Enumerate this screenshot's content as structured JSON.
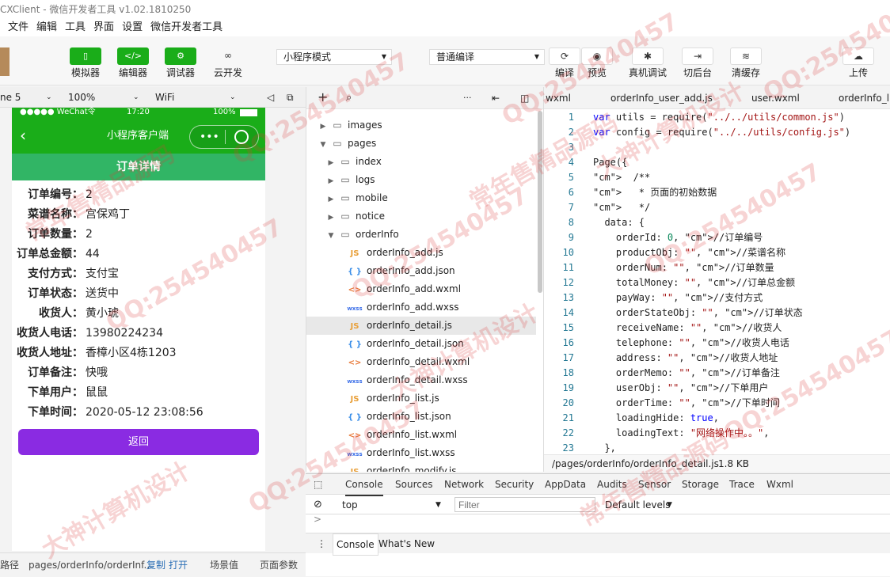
{
  "app": {
    "title": "CXClient - 微信开发者工具 v1.02.1810250"
  },
  "menu": [
    "文件",
    "编辑",
    "工具",
    "界面",
    "设置",
    "微信开发者工具"
  ],
  "toolbar": {
    "simulator": "模拟器",
    "editor": "编辑器",
    "debugger": "调试器",
    "cloud": "云开发",
    "mode": "小程序模式",
    "compile": "普通编译",
    "compile_btn": "编译",
    "preview": "预览",
    "device_debug": "真机调试",
    "background": "切后台",
    "cache": "清缓存",
    "upload": "上传"
  },
  "simbar": {
    "device": "ne 5",
    "zoom": "100%",
    "network": "WiFi"
  },
  "phone": {
    "carrier": "●●●●● WeChat令",
    "time": "17:20",
    "battery": "100%",
    "nav_title": "小程序客户端",
    "page_title": "订单详情",
    "fields": [
      {
        "k": "订单编号：",
        "v": "2"
      },
      {
        "k": "菜谱名称：",
        "v": "宫保鸡丁"
      },
      {
        "k": "订单数量：",
        "v": "2"
      },
      {
        "k": "订单总金额：",
        "v": "44"
      },
      {
        "k": "支付方式：",
        "v": "支付宝"
      },
      {
        "k": "订单状态：",
        "v": "送货中"
      },
      {
        "k": "收货人：",
        "v": "黄小琥"
      },
      {
        "k": "收货人电话：",
        "v": "13980224234"
      },
      {
        "k": "收货人地址：",
        "v": "香樟小区4栋1203"
      },
      {
        "k": "订单备注：",
        "v": "快哦"
      },
      {
        "k": "下单用户：",
        "v": "鼠鼠"
      },
      {
        "k": "下单时间：",
        "v": "2020-05-12 23:08:56"
      }
    ],
    "back": "返回"
  },
  "tree": [
    {
      "label": "images",
      "type": "folder",
      "depth": 0,
      "open": false
    },
    {
      "label": "pages",
      "type": "folder",
      "depth": 0,
      "open": true
    },
    {
      "label": "index",
      "type": "folder",
      "depth": 1,
      "open": false
    },
    {
      "label": "logs",
      "type": "folder",
      "depth": 1,
      "open": false
    },
    {
      "label": "mobile",
      "type": "folder",
      "depth": 1,
      "open": false
    },
    {
      "label": "notice",
      "type": "folder",
      "depth": 1,
      "open": false
    },
    {
      "label": "orderInfo",
      "type": "folder",
      "depth": 1,
      "open": true
    },
    {
      "label": "orderInfo_add.js",
      "type": "js",
      "depth": 2
    },
    {
      "label": "orderInfo_add.json",
      "type": "json",
      "depth": 2
    },
    {
      "label": "orderInfo_add.wxml",
      "type": "wxml",
      "depth": 2
    },
    {
      "label": "orderInfo_add.wxss",
      "type": "wxss",
      "depth": 2
    },
    {
      "label": "orderInfo_detail.js",
      "type": "js",
      "depth": 2,
      "selected": true
    },
    {
      "label": "orderInfo_detail.json",
      "type": "json",
      "depth": 2
    },
    {
      "label": "orderInfo_detail.wxml",
      "type": "wxml",
      "depth": 2
    },
    {
      "label": "orderInfo_detail.wxss",
      "type": "wxss",
      "depth": 2
    },
    {
      "label": "orderInfo_list.js",
      "type": "js",
      "depth": 2
    },
    {
      "label": "orderInfo_list.json",
      "type": "json",
      "depth": 2
    },
    {
      "label": "orderInfo_list.wxml",
      "type": "wxml",
      "depth": 2
    },
    {
      "label": "orderInfo_list.wxss",
      "type": "wxss",
      "depth": 2
    },
    {
      "label": "orderInfo_modify.js",
      "type": "js",
      "depth": 2
    }
  ],
  "file_icons": {
    "js": "JS",
    "json": "{ }",
    "wxml": "<>",
    "wxss": "wxss"
  },
  "editor": {
    "tabs": [
      "wxml",
      "orderInfo_user_add.js",
      "user.wxml",
      "orderInfo_li"
    ],
    "lines": [
      "var utils = require(\"../../utils/common.js\")",
      "var config = require(\"../../utils/config.js\")",
      "",
      "Page({",
      "  /**",
      "   * 页面的初始数据",
      "   */",
      "  data: {",
      "    orderId: 0, //订单编号",
      "    productObj: \"\", //菜谱名称",
      "    orderNum: \"\", //订单数量",
      "    totalMoney: \"\", //订单总金额",
      "    payWay: \"\", //支付方式",
      "    orderStateObj: \"\", //订单状态",
      "    receiveName: \"\", //收货人",
      "    telephone: \"\", //收货人电话",
      "    address: \"\", //收货人地址",
      "    orderMemo: \"\", //订单备注",
      "    userObj: \"\", //下单用户",
      "    orderTime: \"\", //下单时间",
      "    loadingHide: true,",
      "    loadingText: \"网络操作中。。\",",
      "  },"
    ],
    "path": "/pages/orderInfo/orderInfo_detail.js",
    "size": "1.8 KB"
  },
  "devtools": {
    "tabs": [
      "Console",
      "Sources",
      "Network",
      "Security",
      "AppData",
      "Audits",
      "Sensor",
      "Storage",
      "Trace",
      "Wxml"
    ],
    "context": "top",
    "filter_placeholder": "Filter",
    "levels": "Default levels",
    "prompt": ">",
    "bottom_tabs": [
      "Console",
      "What's New"
    ]
  },
  "status": {
    "path_label": "路径",
    "path": "pages/orderInfo/orderInf...",
    "copy": "复制",
    "open": "打开",
    "scene": "场景值",
    "params": "页面参数"
  },
  "watermarks": [
    "QQ:254540457",
    "常年售精品源码",
    "大神计算机设计"
  ]
}
